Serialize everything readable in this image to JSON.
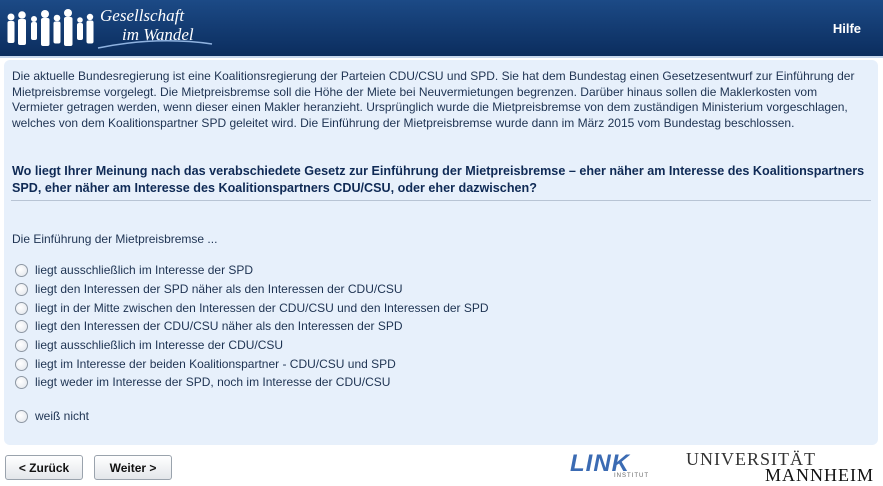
{
  "header": {
    "logo_line1": "Gesellschaft",
    "logo_line2": "im Wandel",
    "help_label": "Hilfe"
  },
  "intro": "Die aktuelle Bundesregierung ist eine Koalitionsregierung der Parteien CDU/CSU und SPD. Sie hat dem Bundestag einen Gesetzesentwurf zur Einführung der Mietpreisbremse vorgelegt. Die Mietpreisbremse soll die Höhe der Miete bei Neuvermietungen begrenzen. Darüber hinaus sollen die Maklerkosten vom Vermieter getragen werden, wenn dieser einen Makler heranzieht. Ursprünglich wurde die Mietpreisbremse von dem zuständigen Ministerium vorgeschlagen, welches von dem Koalitionspartner SPD geleitet wird. Die Einführung der Mietpreisbremse wurde dann im März 2015 vom Bundestag beschlossen.",
  "question": "Wo liegt Ihrer Meinung nach das verabschiedete Gesetz zur Einführung der Mietpreisbremse – eher näher am Interesse des Koalitionspartners SPD, eher näher am Interesse des Koalitionspartners CDU/CSU, oder eher dazwischen?",
  "stem": "Die Einführung der Mietpreisbremse ...",
  "options": [
    "liegt ausschließlich im Interesse der SPD",
    "liegt den Interessen der SPD näher als den Interessen der CDU/CSU",
    "liegt in der Mitte zwischen den Interessen der CDU/CSU und den Interessen der SPD",
    "liegt den Interessen der CDU/CSU näher als den Interessen der SPD",
    "liegt ausschließlich im Interesse der CDU/CSU",
    "liegt im Interesse der beiden Koalitionspartner - CDU/CSU und SPD",
    "liegt weder im Interesse der SPD, noch im Interesse der CDU/CSU"
  ],
  "dont_know": "weiß nicht",
  "nav": {
    "back_label": "< Zurück",
    "next_label": "Weiter >"
  },
  "footer": {
    "link_logo": "LINK",
    "link_sub": "INSTITUT",
    "uni_line1": "UNIVERSITÄT",
    "uni_line2": "MANNHEIM"
  }
}
